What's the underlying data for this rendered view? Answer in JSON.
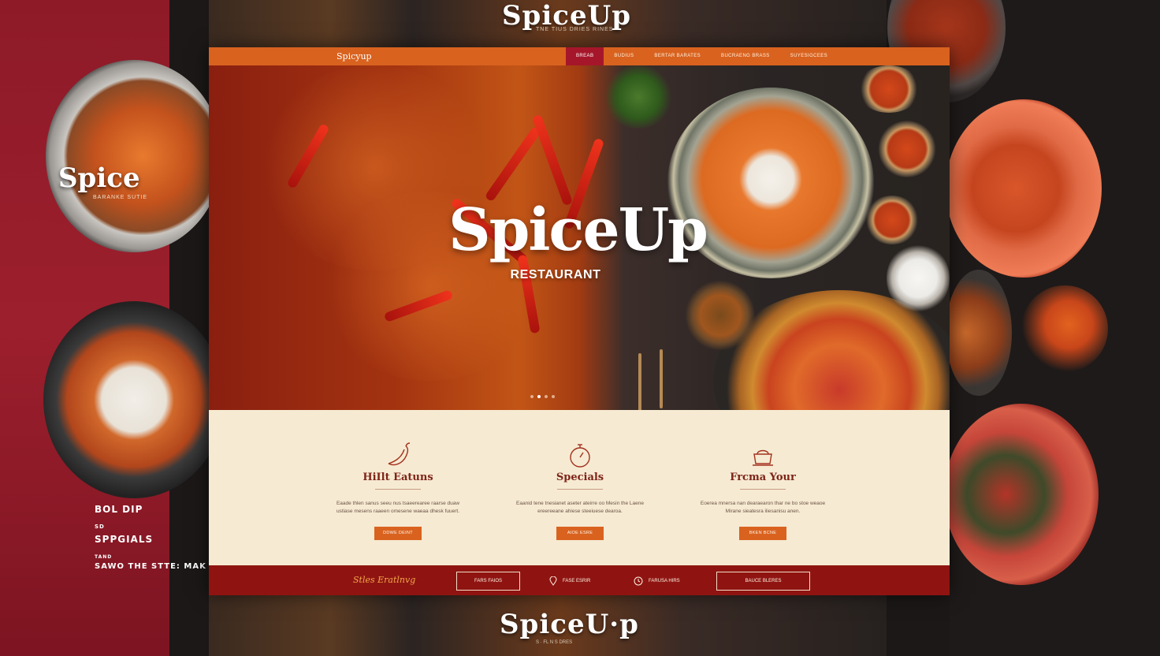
{
  "mockup": {
    "title_top": "SpiceUp",
    "subtitle_top": "TNE TIUS DRIES RINES",
    "title_bottom": "SpiceU·p",
    "subtitle_bottom": "S · FL N S DRES",
    "side_brand": "Spice",
    "side_brand_sub": "BARANKE SUTIE",
    "side_labels": [
      "BOL DIP",
      "SD",
      "SPPGIALS",
      "TAND",
      "SAWO THE STTE: MAK HI"
    ]
  },
  "site": {
    "nav": {
      "logo": "Spicyup",
      "links": [
        {
          "label": "BREAB",
          "active": true
        },
        {
          "label": "BUDIUS",
          "active": false
        },
        {
          "label": "BERTAR BARATES",
          "active": false
        },
        {
          "label": "BUCRAENG BRASS",
          "active": false
        },
        {
          "label": "SUYESIGCEES",
          "active": false
        }
      ]
    },
    "hero": {
      "brand": "SpiceUp",
      "subtitle": "RESTAURANT",
      "dots": 4,
      "active_dot": 2
    },
    "features": [
      {
        "icon": "chili-icon",
        "title": "HiIlt Eatuns",
        "text": "Eaade thlen sanus seeu nus tsaeerearee raarse duaw ustiase mesens raaeen omesene waeaa dhesk fuuert.",
        "button": "DDWE DEINT"
      },
      {
        "icon": "stopwatch-icon",
        "title": "Specials",
        "text": "Eaanid tene tnesianet aseter ateirre oo Mesin the Laene ereereeane ahiese steeiuese dearoa.",
        "button": "AIOE ESRE"
      },
      {
        "icon": "cauldron-icon",
        "title": "Frcma Your",
        "text": "Eoerea mnersa nan dearaearon thar ne bo stoe weaoe Mirane sieatesra iliesanisu anen.",
        "button": "BKEN BCNE"
      }
    ],
    "footer": {
      "script": "Stles Eratlnvg",
      "box_1": "FARS FAIOS",
      "item_1": "FASE ESRIR",
      "item_2": "FARUSA HIRS",
      "box_2": "BAUCE BLERES"
    }
  }
}
